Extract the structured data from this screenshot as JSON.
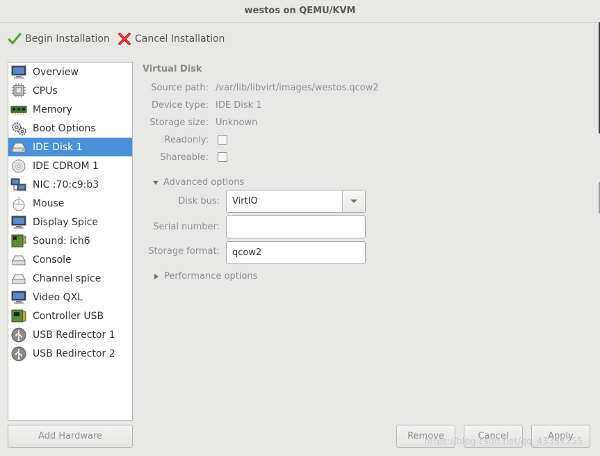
{
  "window": {
    "title": "westos on QEMU/KVM"
  },
  "toolbar": {
    "begin_label": "Begin Installation",
    "cancel_label": "Cancel Installation"
  },
  "sidebar": {
    "items": [
      {
        "label": "Overview",
        "icon": "monitor-icon"
      },
      {
        "label": "CPUs",
        "icon": "cpu-icon"
      },
      {
        "label": "Memory",
        "icon": "memory-icon"
      },
      {
        "label": "Boot Options",
        "icon": "gears-icon"
      },
      {
        "label": "IDE Disk 1",
        "icon": "disk-icon",
        "selected": true
      },
      {
        "label": "IDE CDROM 1",
        "icon": "cdrom-icon"
      },
      {
        "label": "NIC :70:c9:b3",
        "icon": "network-icon"
      },
      {
        "label": "Mouse",
        "icon": "mouse-icon"
      },
      {
        "label": "Display Spice",
        "icon": "monitor-icon"
      },
      {
        "label": "Sound: ich6",
        "icon": "sound-card-icon"
      },
      {
        "label": "Console",
        "icon": "console-icon"
      },
      {
        "label": "Channel spice",
        "icon": "channel-icon"
      },
      {
        "label": "Video QXL",
        "icon": "monitor-icon"
      },
      {
        "label": "Controller USB",
        "icon": "controller-icon"
      },
      {
        "label": "USB Redirector 1",
        "icon": "usb-icon"
      },
      {
        "label": "USB Redirector 2",
        "icon": "usb-icon"
      }
    ],
    "add_hardware_label": "Add Hardware"
  },
  "disk": {
    "section_title": "Virtual Disk",
    "source_path_label": "Source path:",
    "source_path": "/var/lib/libvirt/images/westos.qcow2",
    "device_type_label": "Device type:",
    "device_type": "IDE Disk 1",
    "storage_size_label": "Storage size:",
    "storage_size": "Unknown",
    "readonly_label": "Readonly:",
    "shareable_label": "Shareable:",
    "advanced_label": "Advanced options",
    "disk_bus_label": "Disk bus:",
    "disk_bus": "VirtIO",
    "serial_label": "Serial number:",
    "serial": "",
    "storage_format_label": "Storage format:",
    "storage_format": "qcow2",
    "performance_label": "Performance options"
  },
  "buttons": {
    "remove": "Remove",
    "cancel": "Cancel",
    "apply": "Apply"
  },
  "watermark": "https://blog.csdn.net/qq_43337755",
  "colors": {
    "selection": "#4a90d9",
    "background": "#e8e8e7"
  }
}
